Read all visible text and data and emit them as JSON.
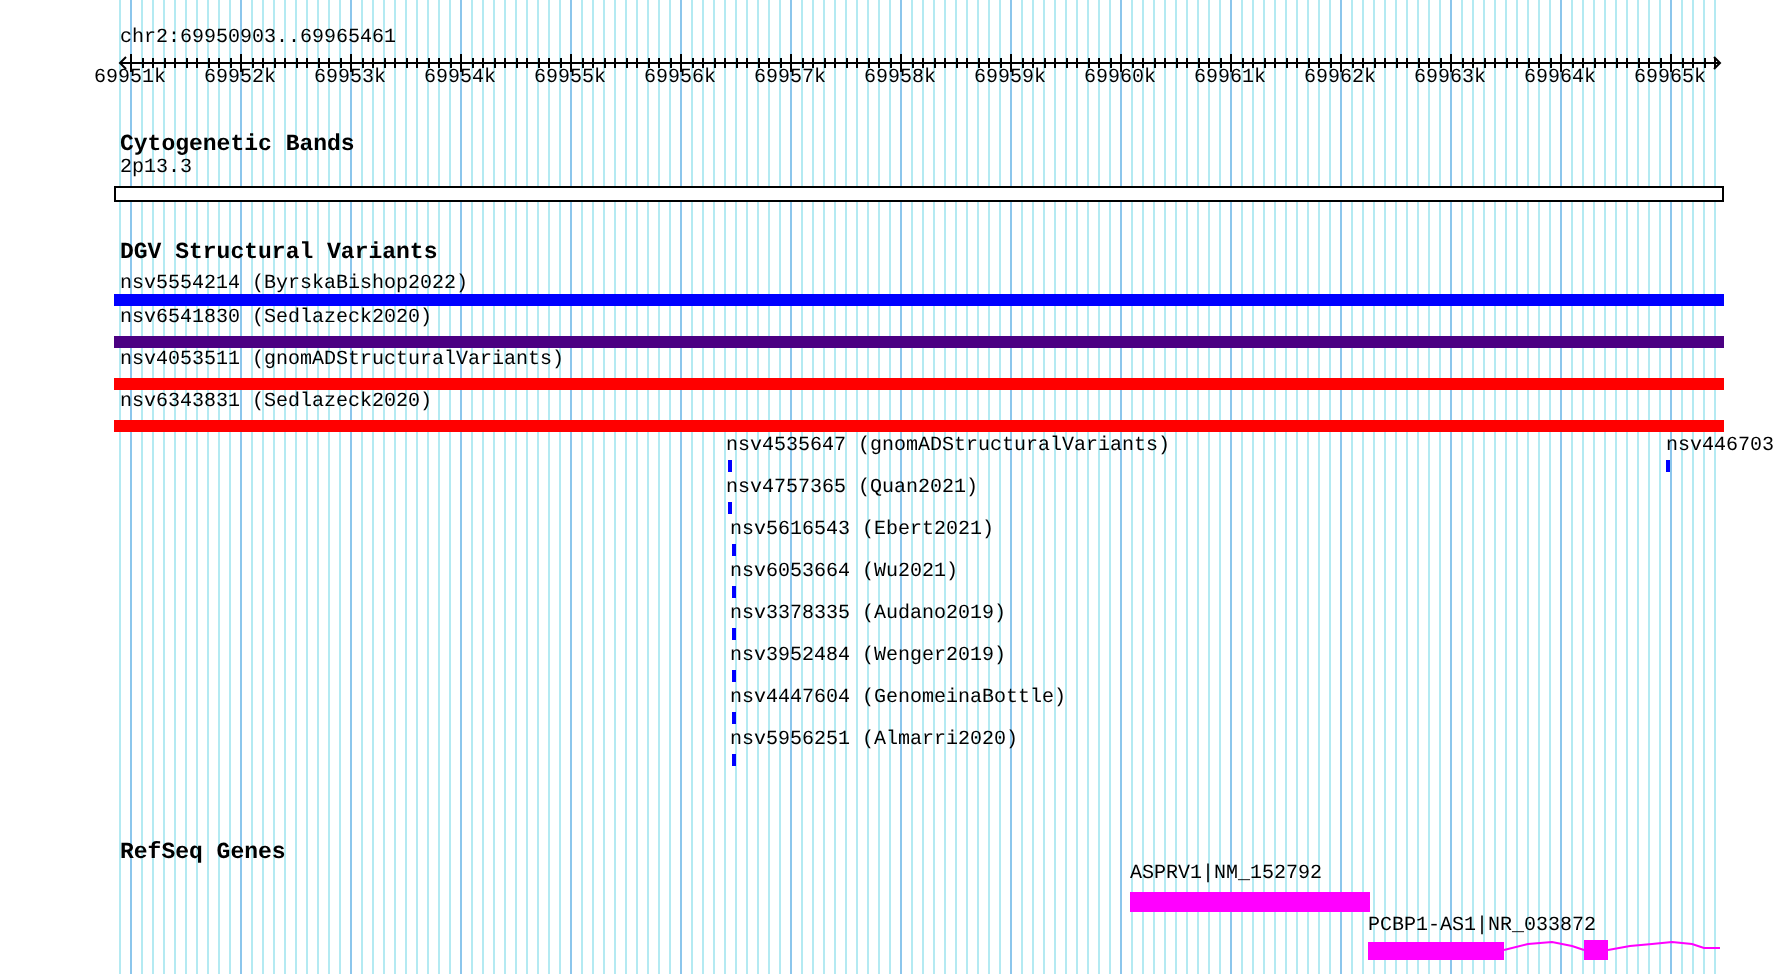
{
  "ruler": {
    "region": "chr2:69950903..69965461",
    "ticks": [
      "69951k",
      "69952k",
      "69953k",
      "69954k",
      "69955k",
      "69956k",
      "69957k",
      "69958k",
      "69959k",
      "69960k",
      "69961k",
      "69962k",
      "69963k",
      "69964k",
      "69965k"
    ]
  },
  "tracks": [
    {
      "kind": "bands",
      "title": "Cytogenetic Bands",
      "features": [
        {
          "label": "2p13.3"
        }
      ]
    },
    {
      "kind": "variants",
      "title": "DGV Structural Variants",
      "features": [
        {
          "label": "nsv5554214 (ByrskaBishop2022)",
          "color": "#0000ff"
        },
        {
          "label": "nsv6541830 (Sedlazeck2020)",
          "color": "#4b0082"
        },
        {
          "label": "nsv4053511 (gnomADStructuralVariants)",
          "color": "#ff0000"
        },
        {
          "label": "nsv6343831 (Sedlazeck2020)",
          "color": "#ff0000"
        },
        {
          "label": "nsv4535647 (gnomADStructuralVariants)",
          "color": "#0000ff"
        },
        {
          "label": "nsv4757365 (Quan2021)",
          "color": "#0000ff"
        },
        {
          "label": "nsv5616543 (Ebert2021)",
          "color": "#0000ff"
        },
        {
          "label": "nsv6053664 (Wu2021)",
          "color": "#0000ff"
        },
        {
          "label": "nsv3378335 (Audano2019)",
          "color": "#0000ff"
        },
        {
          "label": "nsv3952484 (Wenger2019)",
          "color": "#0000ff"
        },
        {
          "label": "nsv4447604 (GenomeinaBottle)",
          "color": "#0000ff"
        },
        {
          "label": "nsv5956251 (Almarri2020)",
          "color": "#0000ff"
        },
        {
          "label": "nsv446703",
          "color": "#0000ff"
        }
      ]
    },
    {
      "kind": "genes",
      "title": "RefSeq Genes",
      "features": [
        {
          "label": "ASPRV1|NM_152792"
        },
        {
          "label": "PCBP1-AS1|NR_033872"
        }
      ]
    }
  ]
}
